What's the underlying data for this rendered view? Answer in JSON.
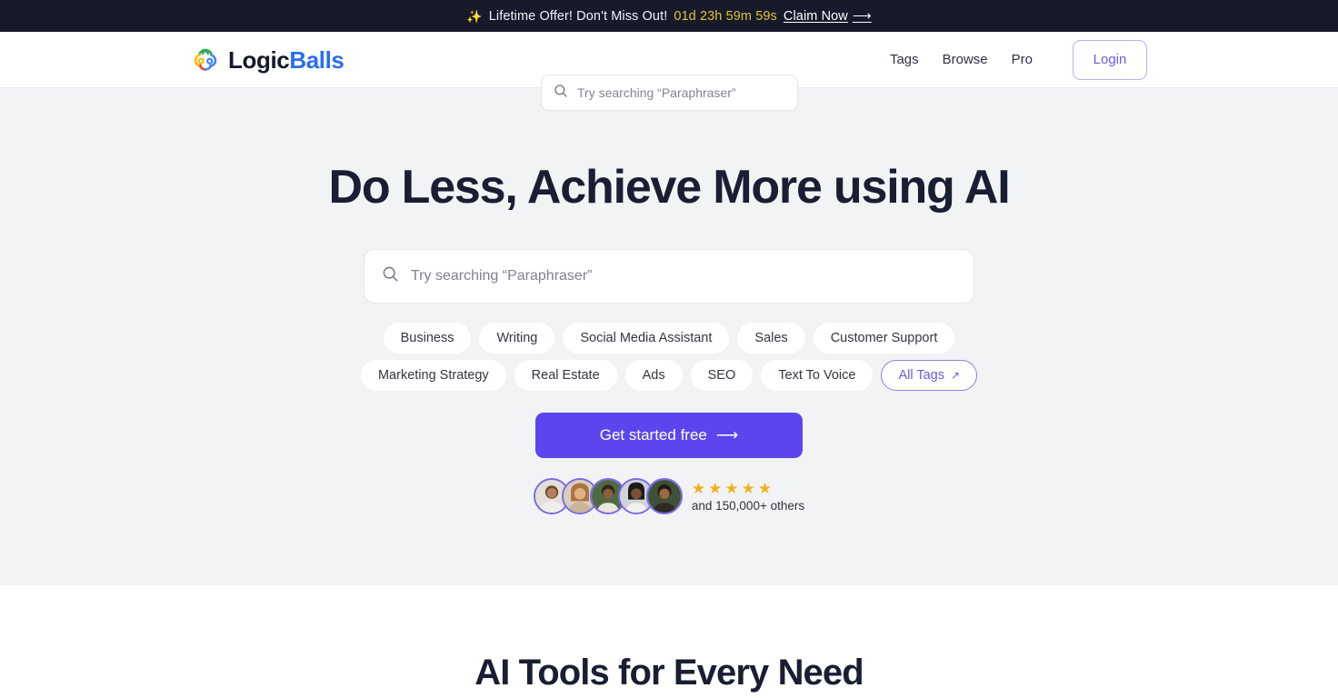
{
  "banner": {
    "sparkle_icon": "✨",
    "text": "Lifetime Offer! Don't Miss Out!",
    "countdown": "01d 23h 59m 59s",
    "claim_label": "Claim Now",
    "claim_arrow": "⟶",
    "bg_color": "#161a2b",
    "countdown_color": "#e3c233"
  },
  "header": {
    "brand": {
      "logic": "Logic",
      "balls": "Balls",
      "accent_color": "#2a6df4"
    },
    "search": {
      "placeholder": "Try searching “Paraphraser”",
      "value": ""
    },
    "nav": [
      {
        "label": "Tags"
      },
      {
        "label": "Browse"
      },
      {
        "label": "Pro"
      }
    ],
    "login_label": "Login",
    "login_color": "#6a5ae0"
  },
  "hero": {
    "title": "Do Less, Achieve More using AI",
    "search": {
      "placeholder": "Try searching “Paraphraser”",
      "value": ""
    },
    "tag_rows": [
      [
        "Business",
        "Writing",
        "Social Media Assistant",
        "Sales",
        "Customer Support"
      ],
      [
        "Marketing Strategy",
        "Real Estate",
        "Ads",
        "SEO",
        "Text To Voice"
      ]
    ],
    "all_tags_label": "All Tags",
    "all_tags_arrow": "↗",
    "cta_label": "Get started free",
    "cta_arrow": "⟶",
    "cta_color": "#5b46ed",
    "social_proof": {
      "avatar_count": 5,
      "stars": 5,
      "star_glyph": "★",
      "star_color": "#f2b01e",
      "text": "and 150,000+ others"
    },
    "bg_color": "#f2f3f5"
  },
  "tools_section": {
    "title": "AI Tools for Every Need"
  }
}
